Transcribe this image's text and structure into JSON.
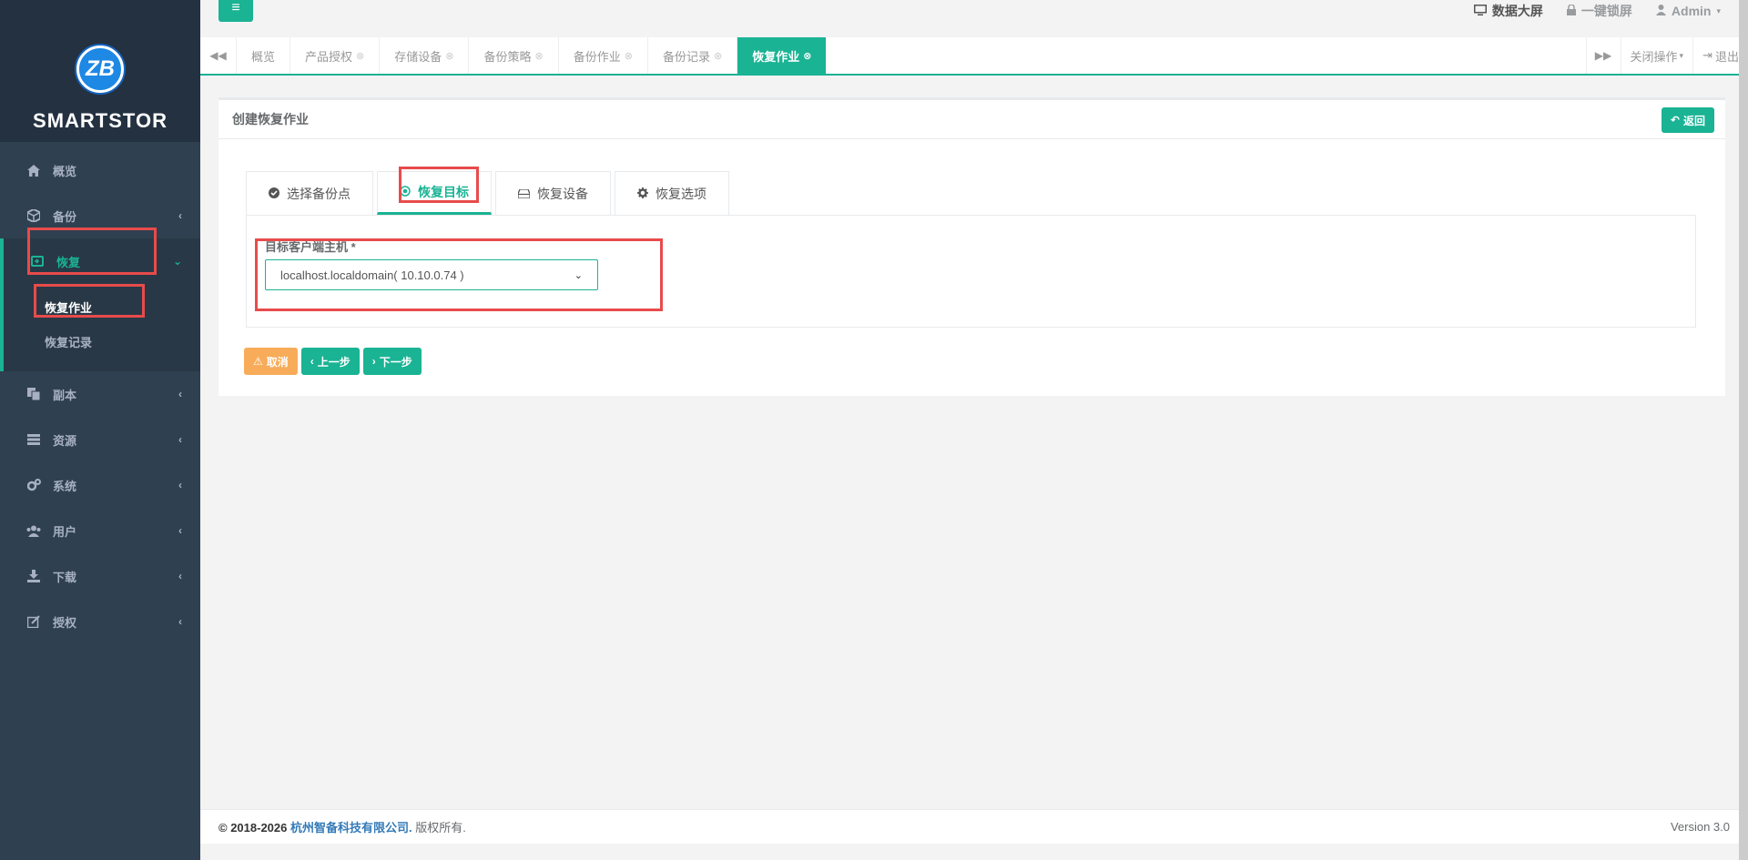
{
  "sidebar": {
    "brand": "SMARTSTOR",
    "logo_letters": "ZB",
    "items": [
      {
        "label": "概览",
        "icon": "home-icon",
        "has_arrow": false
      },
      {
        "label": "备份",
        "icon": "cube-icon",
        "has_arrow": true
      },
      {
        "label": "恢复",
        "icon": "restore-icon",
        "has_arrow": true,
        "active": true
      },
      {
        "label": "副本",
        "icon": "copy-icon",
        "has_arrow": true
      },
      {
        "label": "资源",
        "icon": "server-icon",
        "has_arrow": true
      },
      {
        "label": "系统",
        "icon": "cogs-icon",
        "has_arrow": true
      },
      {
        "label": "用户",
        "icon": "users-icon",
        "has_arrow": true
      },
      {
        "label": "下载",
        "icon": "download-icon",
        "has_arrow": true
      },
      {
        "label": "授权",
        "icon": "edit-icon",
        "has_arrow": true
      }
    ],
    "sub_items": [
      {
        "label": "恢复作业",
        "current": true
      },
      {
        "label": "恢复记录",
        "current": false
      }
    ]
  },
  "topbar": {
    "screen_label": "数据大屏",
    "lock_label": "一键锁屏",
    "user_label": "Admin"
  },
  "tabs": {
    "items": [
      {
        "label": "概览",
        "closable": false
      },
      {
        "label": "产品授权",
        "closable": true
      },
      {
        "label": "存储设备",
        "closable": true
      },
      {
        "label": "备份策略",
        "closable": true
      },
      {
        "label": "备份作业",
        "closable": true
      },
      {
        "label": "备份记录",
        "closable": true
      },
      {
        "label": "恢复作业",
        "closable": true,
        "active": true
      }
    ],
    "close_ops_label": "关闭操作",
    "logout_label": "退出"
  },
  "panel": {
    "title": "创建恢复作业",
    "back_label": "返回",
    "wizard_tabs": [
      {
        "label": "选择备份点",
        "icon": "check-circle-icon"
      },
      {
        "label": "恢复目标",
        "icon": "dot-circle-icon",
        "active": true
      },
      {
        "label": "恢复设备",
        "icon": "hdd-icon"
      },
      {
        "label": "恢复选项",
        "icon": "gear-icon"
      }
    ],
    "target_label": "目标客户端主机 *",
    "target_value": "localhost.localdomain( 10.10.0.74 )",
    "buttons": {
      "cancel": "取消",
      "prev": "上一步",
      "next": "下一步"
    }
  },
  "footer": {
    "copyright": "© 2018-2026",
    "company": "杭州智备科技有限公司.",
    "rights": "版权所有.",
    "version": "Version 3.0"
  },
  "colors": {
    "accent": "#1ab394",
    "sidebar_bg": "#2f4050",
    "warning": "#f8ac59",
    "annotation": "#e84b4b"
  }
}
